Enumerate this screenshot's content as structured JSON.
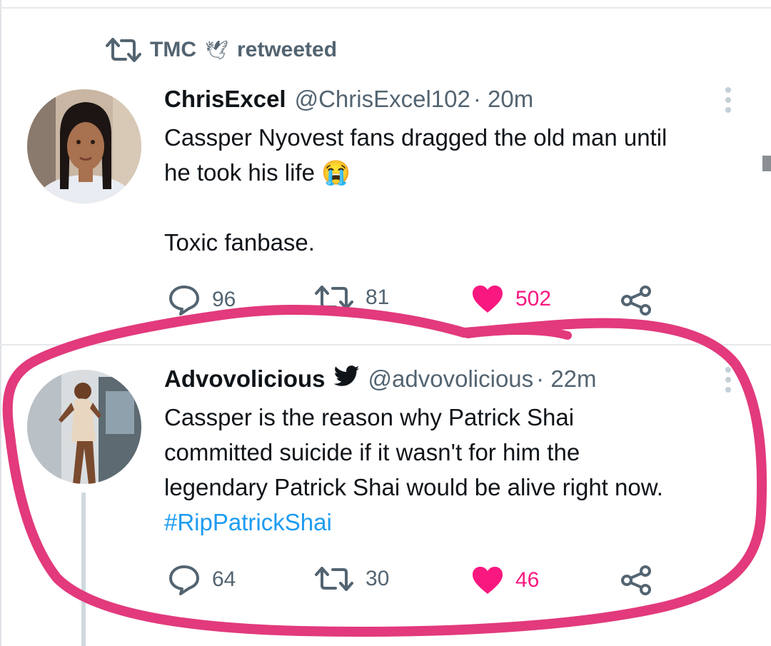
{
  "retweet_banner": {
    "user": "TMC",
    "emoji": "🕊",
    "label": "retweeted"
  },
  "tweets": [
    {
      "display_name": "ChrisExcel",
      "handle": "@ChrisExcel102",
      "time": "· 20m",
      "text_lines": [
        "Cassper Nyovest fans dragged the old man until",
        "he took his life 😭",
        "",
        "Toxic fanbase."
      ],
      "replies": "96",
      "retweets": "81",
      "likes": "502",
      "liked": true
    },
    {
      "display_name": "Advovolicious",
      "verified_bird": true,
      "handle": "@advovolicious",
      "time": "· 22m",
      "text_lines": [
        "Cassper is the reason why Patrick Shai",
        "committed suicide if it wasn't for him the",
        "legendary Patrick Shai would be alive right now."
      ],
      "hashtag": "#RipPatrickShai",
      "replies": "64",
      "retweets": "30",
      "likes": "46",
      "liked": true
    }
  ],
  "colors": {
    "like": "#f91880",
    "muted": "#536471",
    "hashtag": "#1d9bf0",
    "annotation": "#e23a7c"
  }
}
